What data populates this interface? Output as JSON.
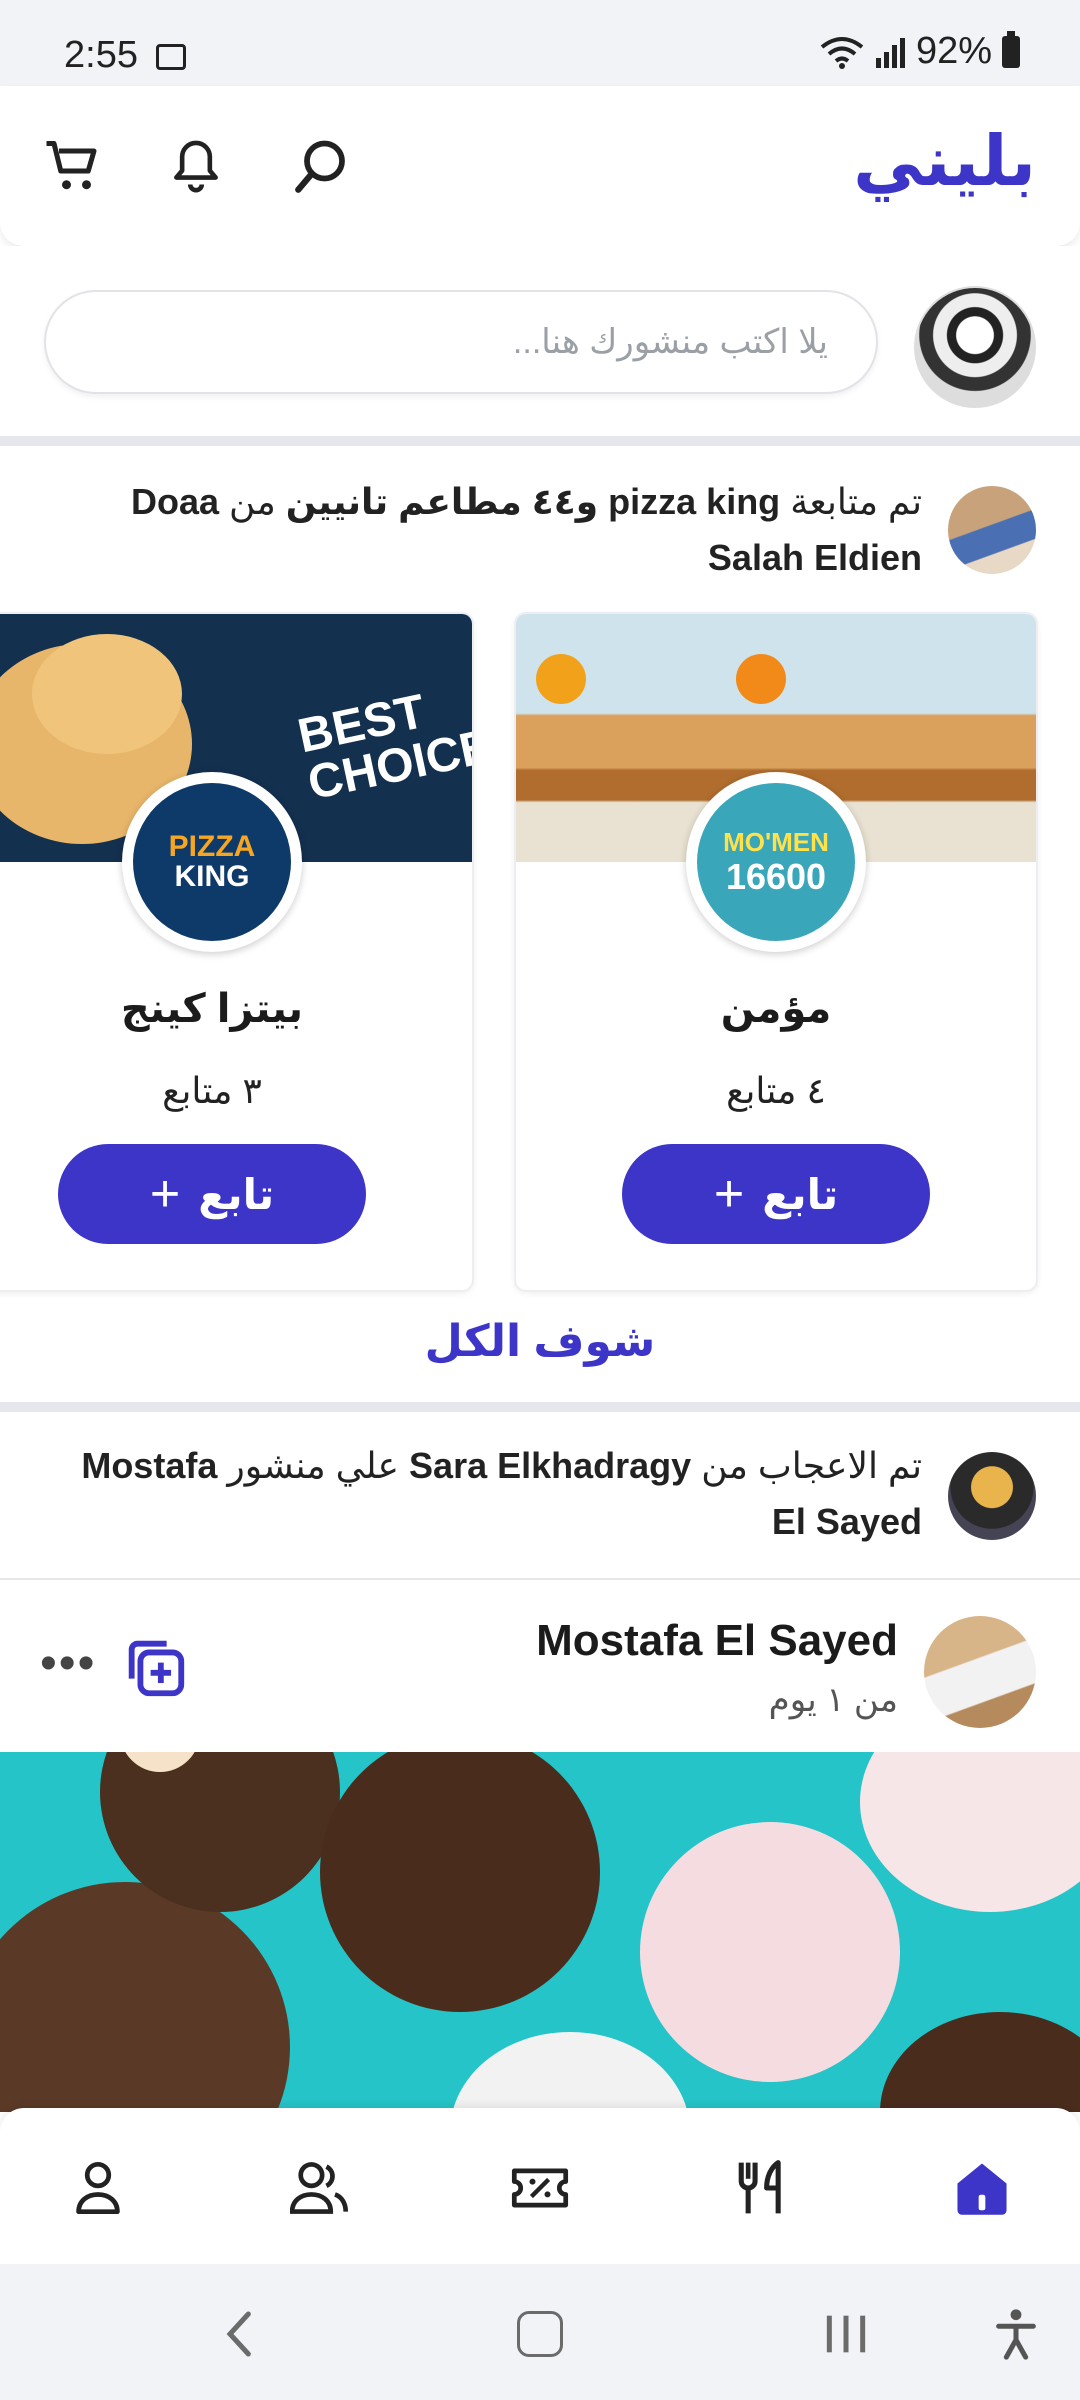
{
  "status_bar": {
    "time": "2:55",
    "battery": "92%"
  },
  "header": {
    "brand": "بليني"
  },
  "composer": {
    "placeholder": "يلا اكتب منشورك هنا..."
  },
  "activity_follow": {
    "prefix": "تم متابعة",
    "restaurant": "pizza king",
    "middle": "و٤٤ مطاعم تانيين",
    "from": "من",
    "user": "Doaa Salah Eldien"
  },
  "cards": [
    {
      "name": "مؤمن",
      "followers": "٤ متابع",
      "follow_label": "تابع",
      "logo_top": "MO'MEN",
      "logo_bottom": "16600",
      "accent": "#3aa6b9"
    },
    {
      "name": "بيتزا كينج",
      "followers": "٣ متابع",
      "follow_label": "تابع",
      "logo_top": "PIZZA",
      "logo_bottom": "KING",
      "accent": "#0d3a68"
    }
  ],
  "see_all": "شوف الكل",
  "activity_like": {
    "prefix": "تم الاعجاب من",
    "liker": "Sara Elkhadragy",
    "middle": "علي منشور",
    "owner": "Mostafa El Sayed"
  },
  "post": {
    "author": "Mostafa El Sayed",
    "time": "من ١ يوم"
  },
  "colors": {
    "accent": "#3d35c8"
  },
  "bottom_nav": [
    "profile-icon",
    "friends-icon",
    "offers-icon",
    "restaurants-icon",
    "home-icon"
  ]
}
